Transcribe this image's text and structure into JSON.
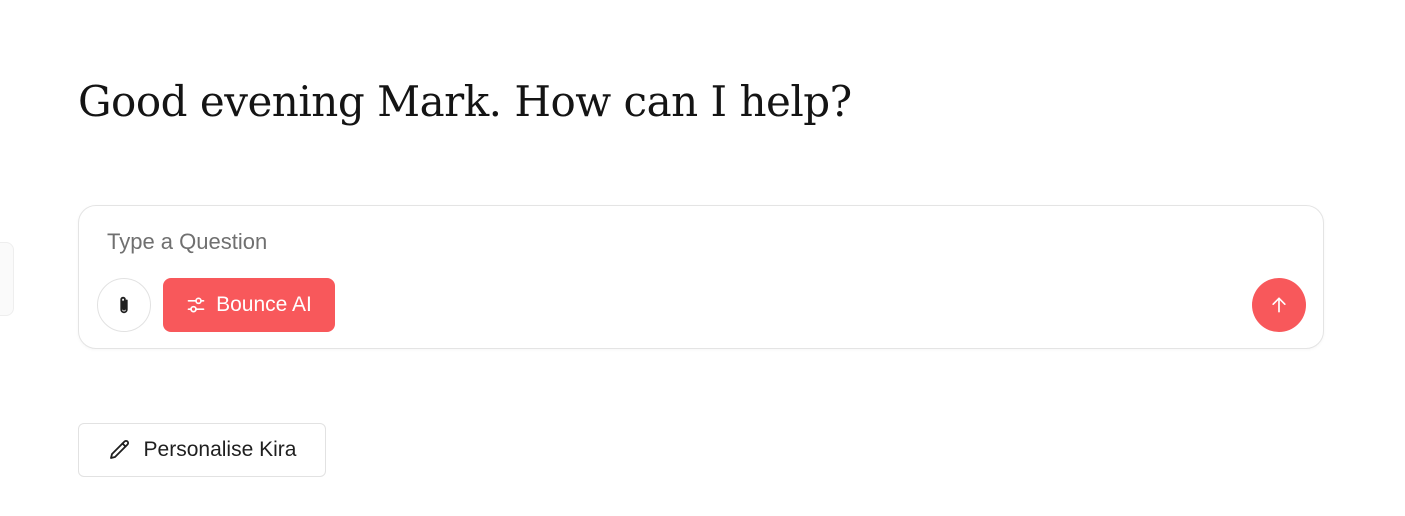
{
  "greeting": {
    "text": "Good evening Mark. How can I help?"
  },
  "composer": {
    "placeholder": "Type a Question",
    "value": "",
    "attach_icon": "paperclip-icon",
    "mode_button": {
      "label": "Bounce AI",
      "icon": "sliders-icon"
    },
    "send_icon": "arrow-up-icon"
  },
  "personalise": {
    "label": "Personalise Kira",
    "icon": "pencil-icon"
  },
  "colors": {
    "accent": "#f8585b",
    "border": "#e4e4e4",
    "text": "#1f1f1f",
    "placeholder": "#707070"
  }
}
